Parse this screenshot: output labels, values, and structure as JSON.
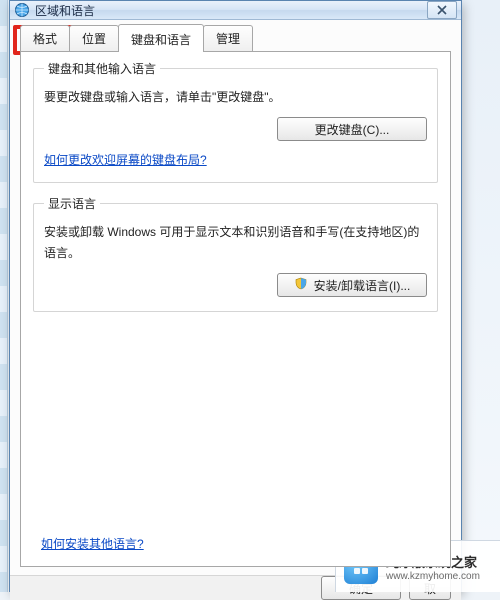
{
  "window": {
    "title": "区域和语言"
  },
  "tabs": {
    "formats": "格式",
    "location": "位置",
    "keyboards": "键盘和语言",
    "admin": "管理"
  },
  "group_keyboard": {
    "legend": "键盘和其他输入语言",
    "desc": "要更改键盘或输入语言，请单击\"更改键盘\"。",
    "change_btn": "更改键盘(C)...",
    "link": "如何更改欢迎屏幕的键盘布局?"
  },
  "group_display": {
    "legend": "显示语言",
    "desc": "安装或卸载 Windows 可用于显示文本和识别语音和手写(在支持地区)的语言。",
    "install_btn": "安装/卸载语言(I)..."
  },
  "bottom_link": "如何安装其他语言?",
  "footer": {
    "ok": "确定",
    "cancel": "取"
  },
  "watermark": {
    "name": "纯净版系统之家",
    "url": "www.kzmyhome.com"
  }
}
